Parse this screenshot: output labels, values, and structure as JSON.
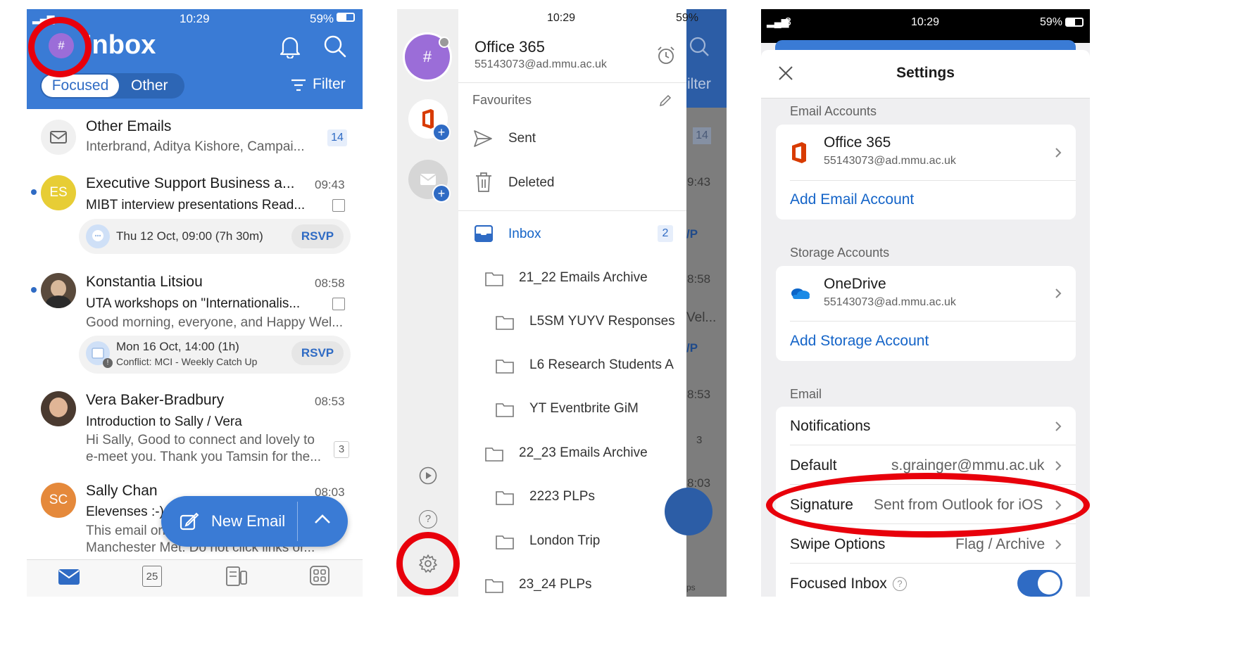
{
  "status": {
    "time": "10:29",
    "battery": "59%",
    "carrier": "3"
  },
  "inbox": {
    "title": "Inbox",
    "avatar_symbol": "#",
    "tab_focused": "Focused",
    "tab_other": "Other",
    "filter_label": "Filter",
    "other_emails": {
      "sender": "Other Emails",
      "preview": "Interbrand, Aditya Kishore, Campai...",
      "count": "14"
    },
    "messages": [
      {
        "initials": "ES",
        "sender": "Executive Support Business a...",
        "time": "09:43",
        "subject": "MIBT interview presentations Read...",
        "event": "Thu 12 Oct, 09:00 (7h 30m)",
        "rsvp": "RSVP"
      },
      {
        "sender": "Konstantia Litsiou",
        "time": "08:58",
        "subject": "UTA workshops on \"Internationalis...",
        "preview": "Good morning, everyone, and Happy Wel...",
        "event": "Mon 16 Oct, 14:00 (1h)",
        "conflict": "Conflict: MCI - Weekly Catch Up",
        "rsvp": "RSVP"
      },
      {
        "sender": "Vera Baker-Bradbury",
        "time": "08:53",
        "subject": "Introduction to Sally / Vera",
        "preview_line1": "Hi Sally, Good to connect and lovely to",
        "preview_line2": "e-meet you. Thank you Tamsin for the...",
        "count": "3"
      },
      {
        "initials": "SC",
        "sender": "Sally Chan",
        "time": "08:03",
        "subject": "Elevenses :-)",
        "preview_line1": "This email originated from outside",
        "preview_line2": "Manchester Met. Do not click links or..."
      }
    ],
    "new_email_label": "New Email",
    "bottom_tabs": [
      "Email",
      "Calendar",
      "Feed",
      "Apps"
    ],
    "calendar_day": "25"
  },
  "drawer": {
    "account_name": "Office 365",
    "account_email": "55143073@ad.mmu.ac.uk",
    "avatar_symbol": "#",
    "favourites_label": "Favourites",
    "favourites": [
      {
        "label": "Sent",
        "icon": "send-icon"
      },
      {
        "label": "Deleted",
        "icon": "trash-icon"
      }
    ],
    "inbox_label": "Inbox",
    "inbox_count": "2",
    "folders": [
      {
        "label": "21_22 Emails Archive",
        "level": 1
      },
      {
        "label": "L5SM YUYV Responses",
        "level": 2
      },
      {
        "label": "L6 Research Students A",
        "level": 2
      },
      {
        "label": "YT Eventbrite GiM",
        "level": 2
      },
      {
        "label": "22_23 Emails Archive",
        "level": 1
      },
      {
        "label": "2223 PLPs",
        "level": 2
      },
      {
        "label": "London Trip",
        "level": 2
      },
      {
        "label": "23_24 PLPs",
        "level": 1
      }
    ],
    "peek": {
      "filter": "ilter",
      "count": "14",
      "time1": "9:43",
      "rsvp1": "/P",
      "time2": "8:58",
      "preview2": "Vel...",
      "rsvp2": "/P",
      "time3": "8:53",
      "count3": "3",
      "time4": "8:03",
      "tab": "ps"
    }
  },
  "settings": {
    "title": "Settings",
    "email_accounts_header": "Email Accounts",
    "account_name": "Office 365",
    "account_email": "55143073@ad.mmu.ac.uk",
    "add_email_account": "Add Email Account",
    "storage_header": "Storage Accounts",
    "storage_name": "OneDrive",
    "storage_email": "55143073@ad.mmu.ac.uk",
    "add_storage_account": "Add Storage Account",
    "email_header": "Email",
    "rows": [
      {
        "label": "Notifications",
        "value": ""
      },
      {
        "label": "Default",
        "value": "s.grainger@mmu.ac.uk"
      },
      {
        "label": "Signature",
        "value": "Sent from Outlook for iOS"
      },
      {
        "label": "Swipe Options",
        "value": "Flag / Archive"
      },
      {
        "label": "Focused Inbox",
        "value": ""
      }
    ],
    "focused_inbox_on": true
  },
  "colors": {
    "outlook_blue": "#3a7bd5",
    "link_blue": "#1464c8",
    "annotation_red": "#e8000b",
    "avatar_purple": "#9b6dd8",
    "es_yellow": "#e7cd35",
    "sc_orange": "#e5893b"
  }
}
